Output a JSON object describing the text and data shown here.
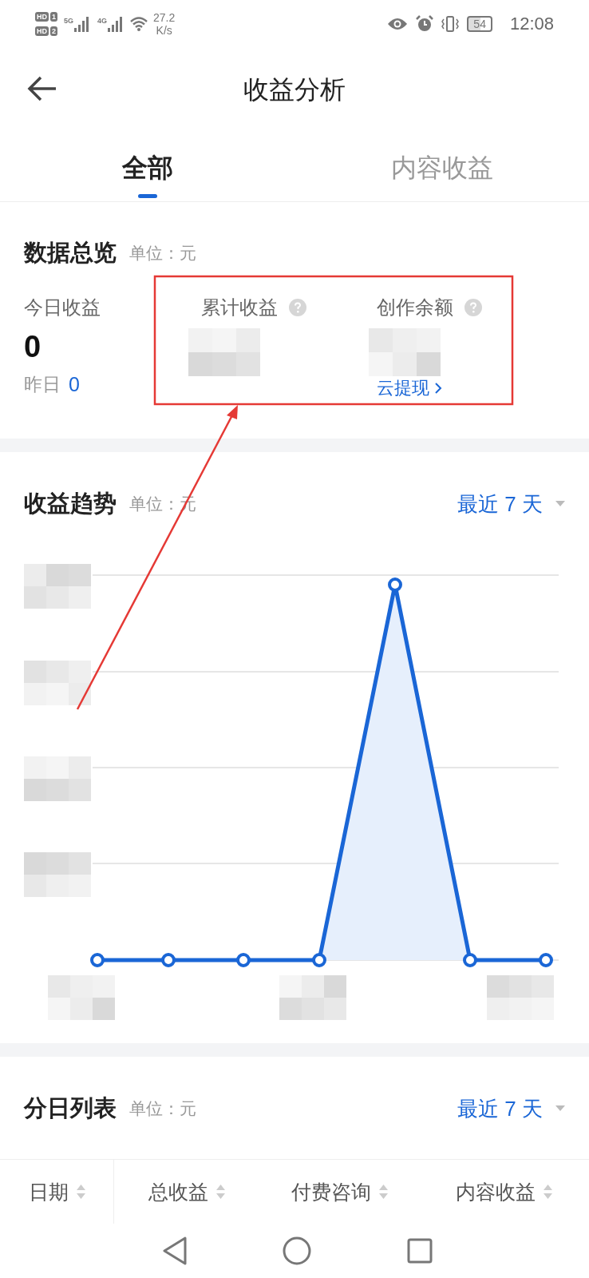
{
  "status_bar": {
    "sims": [
      {
        "label": "HD",
        "slot": "1"
      },
      {
        "label": "HD",
        "slot": "2"
      }
    ],
    "networks": [
      "5G",
      "4G"
    ],
    "speed": "27.2",
    "speed_unit": "K/s",
    "battery": "54",
    "time": "12:08"
  },
  "header": {
    "title": "收益分析"
  },
  "tabs": [
    {
      "label": "全部",
      "selected": true
    },
    {
      "label": "内容收益",
      "selected": false
    }
  ],
  "overview": {
    "title": "数据总览",
    "unit": "单位：元",
    "metrics": [
      {
        "kind": "plain",
        "label": "今日收益",
        "value": "0",
        "sub_label": "昨日",
        "sub_value": "0"
      },
      {
        "kind": "hidden",
        "label": "累计收益",
        "help": true
      },
      {
        "kind": "hidden",
        "label": "创作余额",
        "help": true,
        "link": "云提现"
      }
    ]
  },
  "trend": {
    "title": "收益趋势",
    "unit": "单位：元",
    "range": "最近 7 天"
  },
  "daily": {
    "title": "分日列表",
    "unit": "单位：元",
    "range": "最近 7 天",
    "columns": [
      "日期",
      "总收益",
      "付费咨询",
      "内容收益"
    ]
  },
  "annotation": {
    "kind": "box-arrow",
    "color": "#e53935"
  }
}
